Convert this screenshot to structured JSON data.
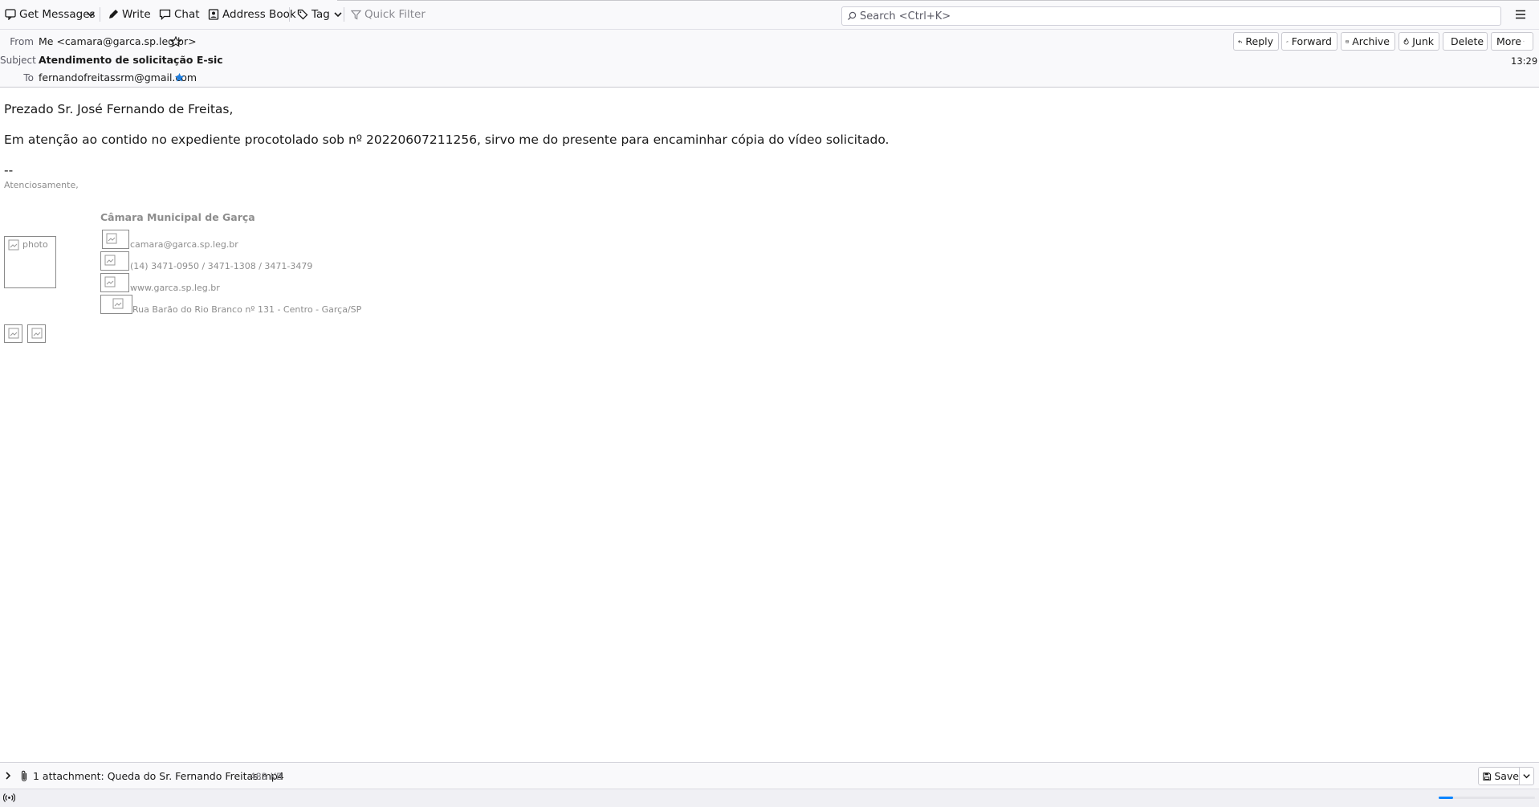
{
  "toolbar": {
    "get_messages": "Get Messages",
    "write": "Write",
    "chat": "Chat",
    "address_book": "Address Book",
    "tag": "Tag",
    "quick_filter": "Quick Filter",
    "search_placeholder": "Search <Ctrl+K>"
  },
  "header": {
    "from_label": "From",
    "from_value": "Me <camara@garca.sp.leg.br>",
    "subject_label": "Subject",
    "subject_value": "Atendimento de solicitação E-sic",
    "to_label": "To",
    "to_value": "fernandofreitassrm@gmail.com",
    "time": "13:29",
    "buttons": {
      "reply": "Reply",
      "forward": "Forward",
      "archive": "Archive",
      "junk": "Junk",
      "delete": "Delete",
      "more": "More"
    }
  },
  "message": {
    "greeting": "Prezado Sr. José Fernando de Freitas,",
    "paragraph": "Em atenção ao contido no expediente procotolado sob nº 20220607211256, sirvo me do presente para encaminhar cópia do vídeo solicitado.",
    "dashes": "--",
    "closing": "Atenciosamente,",
    "signature": {
      "org": "Câmara Municipal de Garça",
      "photo_alt": "photo",
      "email": "camara@garca.sp.leg.br",
      "phone": "(14) 3471-0950 / 3471-1308 / 3471-3479",
      "website": "www.garca.sp.leg.br",
      "address": "Rua Barão do Rio Branco nº 131 - Centro - Garça/SP"
    }
  },
  "attachment": {
    "summary": "1 attachment: Queda do Sr. Fernando Freitas.mp4",
    "size": "483 KB",
    "save_label": "Save"
  },
  "status": {
    "progress": 0.15
  }
}
